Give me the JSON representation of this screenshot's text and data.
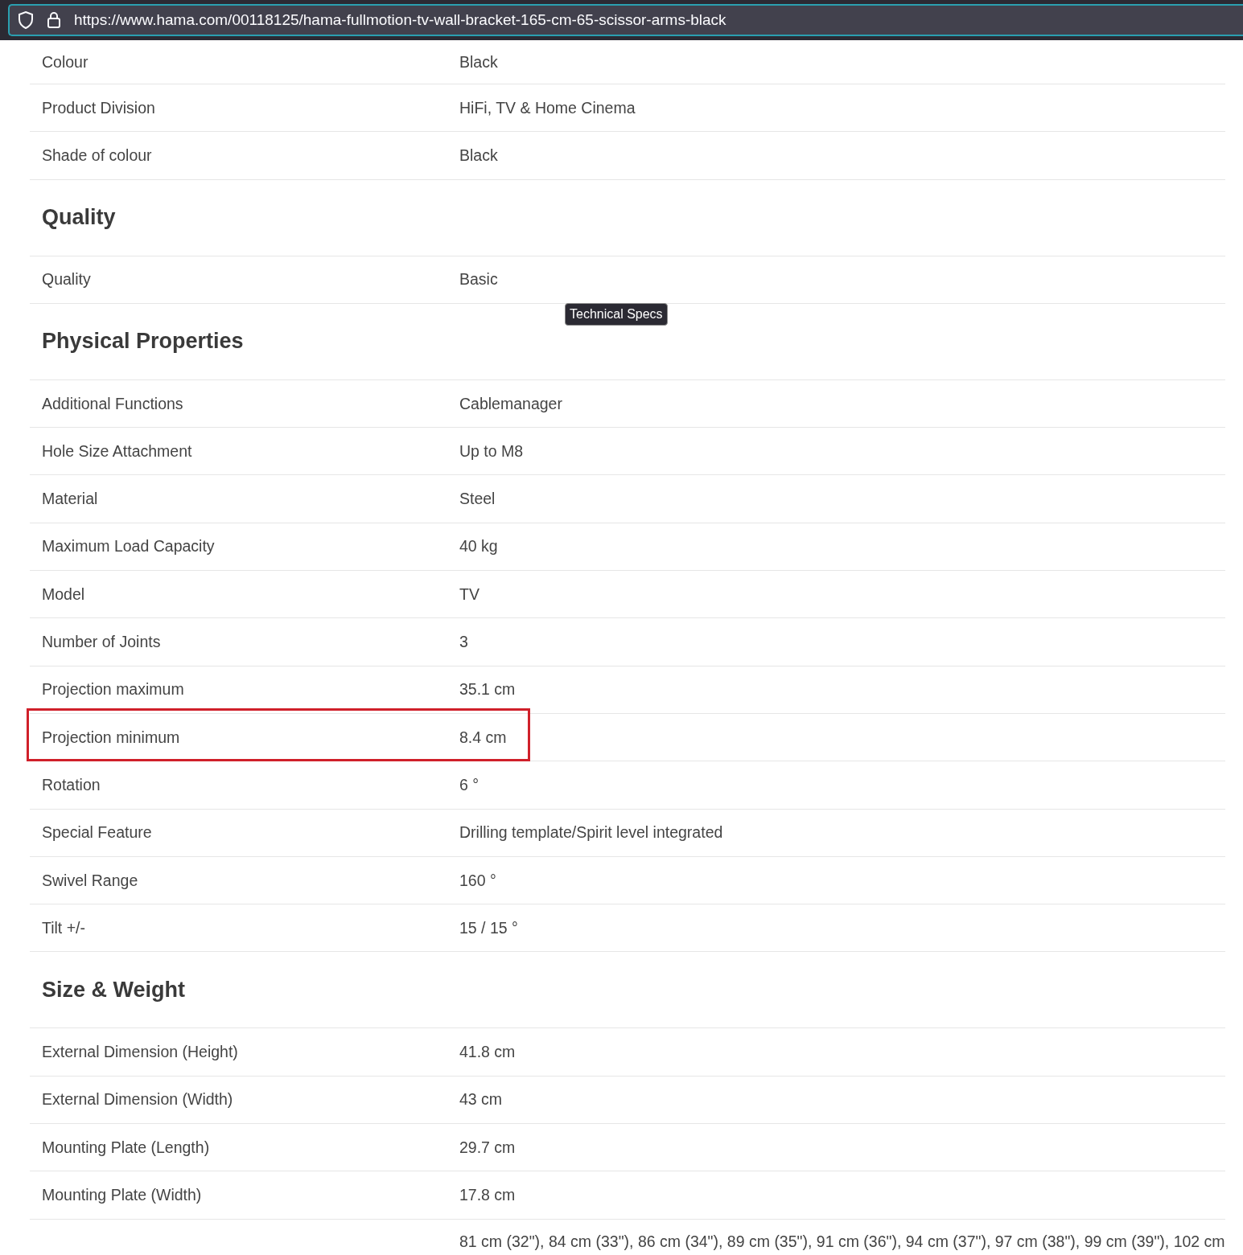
{
  "address_bar": {
    "url": "https://www.hama.com/00118125/hama-fullmotion-tv-wall-bracket-165-cm-65-scissor-arms-black"
  },
  "tooltip": "Technical Specs",
  "sections": [
    {
      "rows": [
        {
          "label": "Colour",
          "value": "Black",
          "highlighted": false
        },
        {
          "label": "Product Division",
          "value": "HiFi, TV & Home Cinema",
          "highlighted": false
        },
        {
          "label": "Shade of colour",
          "value": "Black",
          "highlighted": false
        }
      ]
    },
    {
      "heading": "Quality",
      "rows": [
        {
          "label": "Quality",
          "value": "Basic",
          "highlighted": false
        }
      ]
    },
    {
      "heading": "Physical Properties",
      "rows": [
        {
          "label": "Additional Functions",
          "value": "Cablemanager",
          "highlighted": false
        },
        {
          "label": "Hole Size Attachment",
          "value": "Up to M8",
          "highlighted": false
        },
        {
          "label": "Material",
          "value": "Steel",
          "highlighted": false
        },
        {
          "label": "Maximum Load Capacity",
          "value": "40 kg",
          "highlighted": false
        },
        {
          "label": "Model",
          "value": "TV",
          "highlighted": false
        },
        {
          "label": "Number of Joints",
          "value": "3",
          "highlighted": false
        },
        {
          "label": "Projection maximum",
          "value": "35.1 cm",
          "highlighted": false
        },
        {
          "label": "Projection minimum",
          "value": "8.4 cm",
          "highlighted": true
        },
        {
          "label": "Rotation",
          "value": "6 °",
          "highlighted": false
        },
        {
          "label": "Special Feature",
          "value": "Drilling template/Spirit level integrated",
          "highlighted": false
        },
        {
          "label": "Swivel Range",
          "value": "160 °",
          "highlighted": false
        },
        {
          "label": "Tilt +/-",
          "value": "15 / 15 °",
          "highlighted": false
        }
      ]
    },
    {
      "heading": "Size & Weight",
      "rows": [
        {
          "label": "External Dimension (Height)",
          "value": "41.8 cm",
          "highlighted": false
        },
        {
          "label": "External Dimension (Width)",
          "value": "43 cm",
          "highlighted": false
        },
        {
          "label": "Mounting Plate (Length)",
          "value": "29.7 cm",
          "highlighted": false
        },
        {
          "label": "Mounting Plate (Width)",
          "value": "17.8 cm",
          "highlighted": false
        },
        {
          "label": null,
          "value": "81 cm (32\"), 84 cm (33\"), 86 cm (34\"), 89 cm (35\"), 91 cm (36\"), 94 cm (37\"), 97 cm (38\"), 99 cm (39\"), 102 cm",
          "highlighted": false
        }
      ]
    }
  ]
}
